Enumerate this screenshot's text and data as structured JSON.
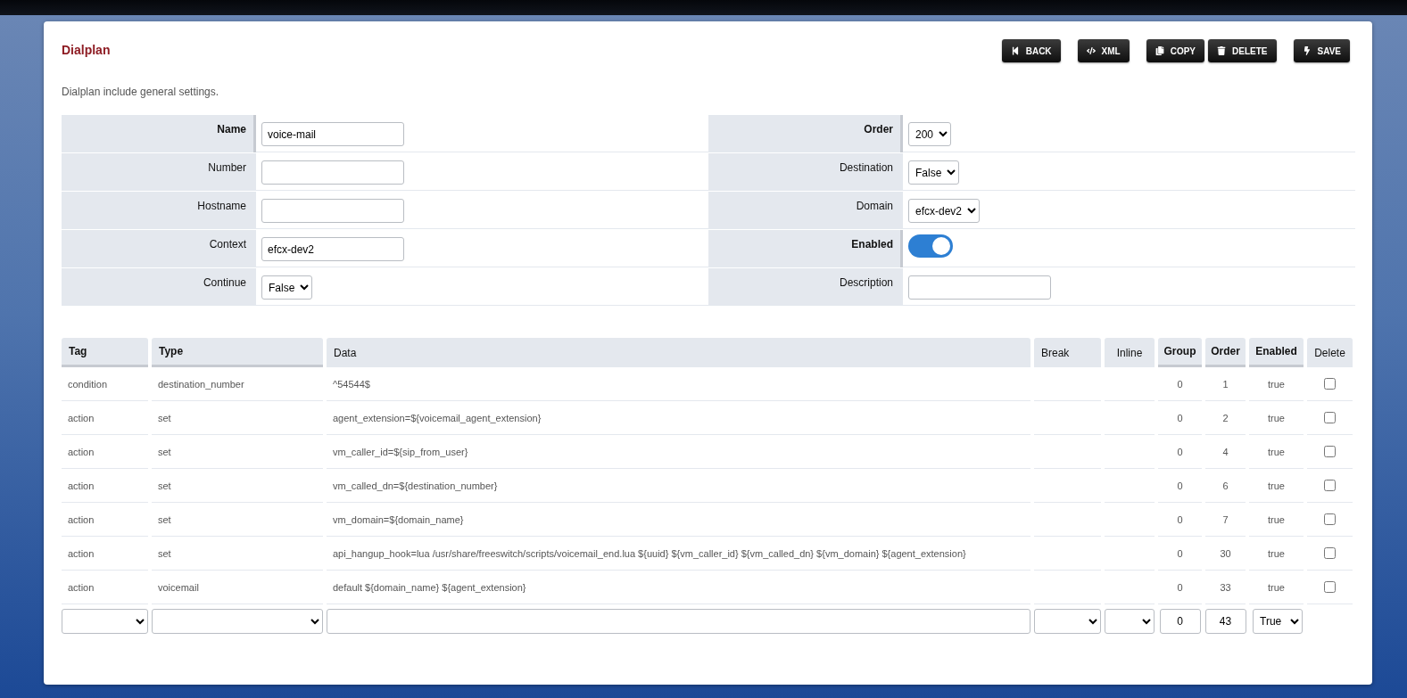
{
  "page": {
    "title": "Dialplan",
    "description": "Dialplan include general settings."
  },
  "action_groups": [
    [
      {
        "kind": "back",
        "label": "BACK"
      }
    ],
    [
      {
        "kind": "xml",
        "label": "XML"
      }
    ],
    [
      {
        "kind": "copy",
        "label": "COPY"
      },
      {
        "kind": "delete",
        "label": "DELETE"
      }
    ],
    [
      {
        "kind": "save",
        "label": "SAVE"
      }
    ]
  ],
  "form_rows": [
    {
      "left": {
        "label": "Name",
        "required": true,
        "kind": "text",
        "value": "voice-mail"
      },
      "right": {
        "label": "Order",
        "required": true,
        "kind": "select",
        "value": "200"
      }
    },
    {
      "left": {
        "label": "Number",
        "required": false,
        "kind": "text"
      },
      "right": {
        "label": "Destination",
        "required": false,
        "kind": "select",
        "value": "False"
      }
    },
    {
      "left": {
        "label": "Hostname",
        "required": false,
        "kind": "text"
      },
      "right": {
        "label": "Domain",
        "required": false,
        "kind": "select",
        "value": "efcx-dev2"
      }
    },
    {
      "left": {
        "label": "Context",
        "required": false,
        "kind": "text",
        "value": "efcx-dev2"
      },
      "right": {
        "label": "Enabled",
        "required": true,
        "kind": "toggle",
        "on": true
      }
    },
    {
      "left": {
        "label": "Continue",
        "required": false,
        "kind": "select",
        "value": "False"
      },
      "right": {
        "label": "Description",
        "required": false,
        "kind": "text"
      }
    }
  ],
  "rules": {
    "columns": [
      {
        "label": "Tag",
        "sortable": true
      },
      {
        "label": "Type",
        "sortable": true
      },
      {
        "label": "Data",
        "sortable": false
      },
      {
        "label": "Break",
        "sortable": false
      },
      {
        "label": "Inline",
        "sortable": false
      },
      {
        "label": "Group",
        "sortable": true
      },
      {
        "label": "Order",
        "sortable": true
      },
      {
        "label": "Enabled",
        "sortable": true
      },
      {
        "label": "Delete",
        "sortable": false
      }
    ],
    "rows": [
      {
        "tag": "condition",
        "type": "destination_number",
        "data": "^54544$",
        "group": "0",
        "order": "1",
        "enabled": "true",
        "delete": false
      },
      {
        "tag": "action",
        "type": "set",
        "data": "agent_extension=${voicemail_agent_extension}",
        "group": "0",
        "order": "2",
        "enabled": "true",
        "delete": false
      },
      {
        "tag": "action",
        "type": "set",
        "data": "vm_caller_id=${sip_from_user}",
        "group": "0",
        "order": "4",
        "enabled": "true",
        "delete": false
      },
      {
        "tag": "action",
        "type": "set",
        "data": "vm_called_dn=${destination_number}",
        "group": "0",
        "order": "6",
        "enabled": "true",
        "delete": false
      },
      {
        "tag": "action",
        "type": "set",
        "data": "vm_domain=${domain_name}",
        "group": "0",
        "order": "7",
        "enabled": "true",
        "delete": false
      },
      {
        "tag": "action",
        "type": "set",
        "data": "api_hangup_hook=lua /usr/share/freeswitch/scripts/voicemail_end.lua ${uuid} ${vm_caller_id} ${vm_called_dn} ${vm_domain} ${agent_extension}",
        "group": "0",
        "order": "30",
        "enabled": "true",
        "delete": false
      },
      {
        "tag": "action",
        "type": "voicemail",
        "data": "default ${domain_name} ${agent_extension}",
        "group": "0",
        "order": "33",
        "enabled": "true",
        "delete": false
      }
    ],
    "new_row": [
      {
        "kind": "select"
      },
      {
        "kind": "select"
      },
      {
        "kind": "text"
      },
      {
        "kind": "select"
      },
      {
        "kind": "select"
      },
      {
        "kind": "number",
        "value": "0"
      },
      {
        "kind": "number",
        "value": "43"
      },
      {
        "kind": "select",
        "value": "True"
      }
    ]
  }
}
